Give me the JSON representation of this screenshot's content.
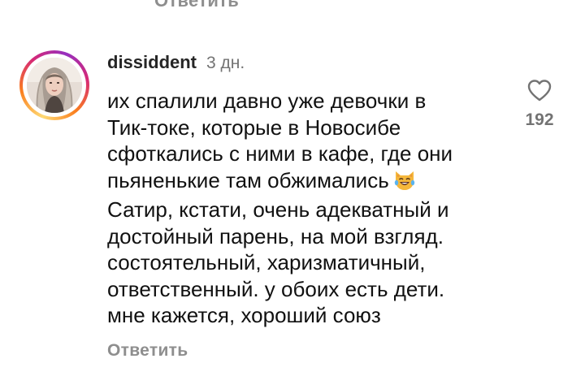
{
  "previous_comment": {
    "reply_label": "Ответить"
  },
  "comment": {
    "username": "dissiddent",
    "time": "3 дн.",
    "lines": [
      "их спалили давно уже девочки в",
      "Тик-токе, которые в Новосибе",
      "сфоткались с ними в кафе, где они",
      "пьяненькие там обжимались",
      "Сатир, кстати, очень адекватный и",
      "достойный парень, на мой взгляд.",
      "состоятельный, харизматичный,",
      "ответственный. у обоих есть дети.",
      "мне кажется, хороший союз"
    ],
    "emoji": "crying-laughing-cat",
    "reply_label": "Ответить",
    "like_count": "192"
  },
  "colors": {
    "secondary_text": "#737373",
    "reply_text": "#8e8e8e",
    "story_ring": [
      "#feda75",
      "#fa7e1e",
      "#d62976",
      "#962fbf"
    ]
  },
  "icons": {
    "like": "heart-outline-icon",
    "avatar": "user-avatar"
  }
}
